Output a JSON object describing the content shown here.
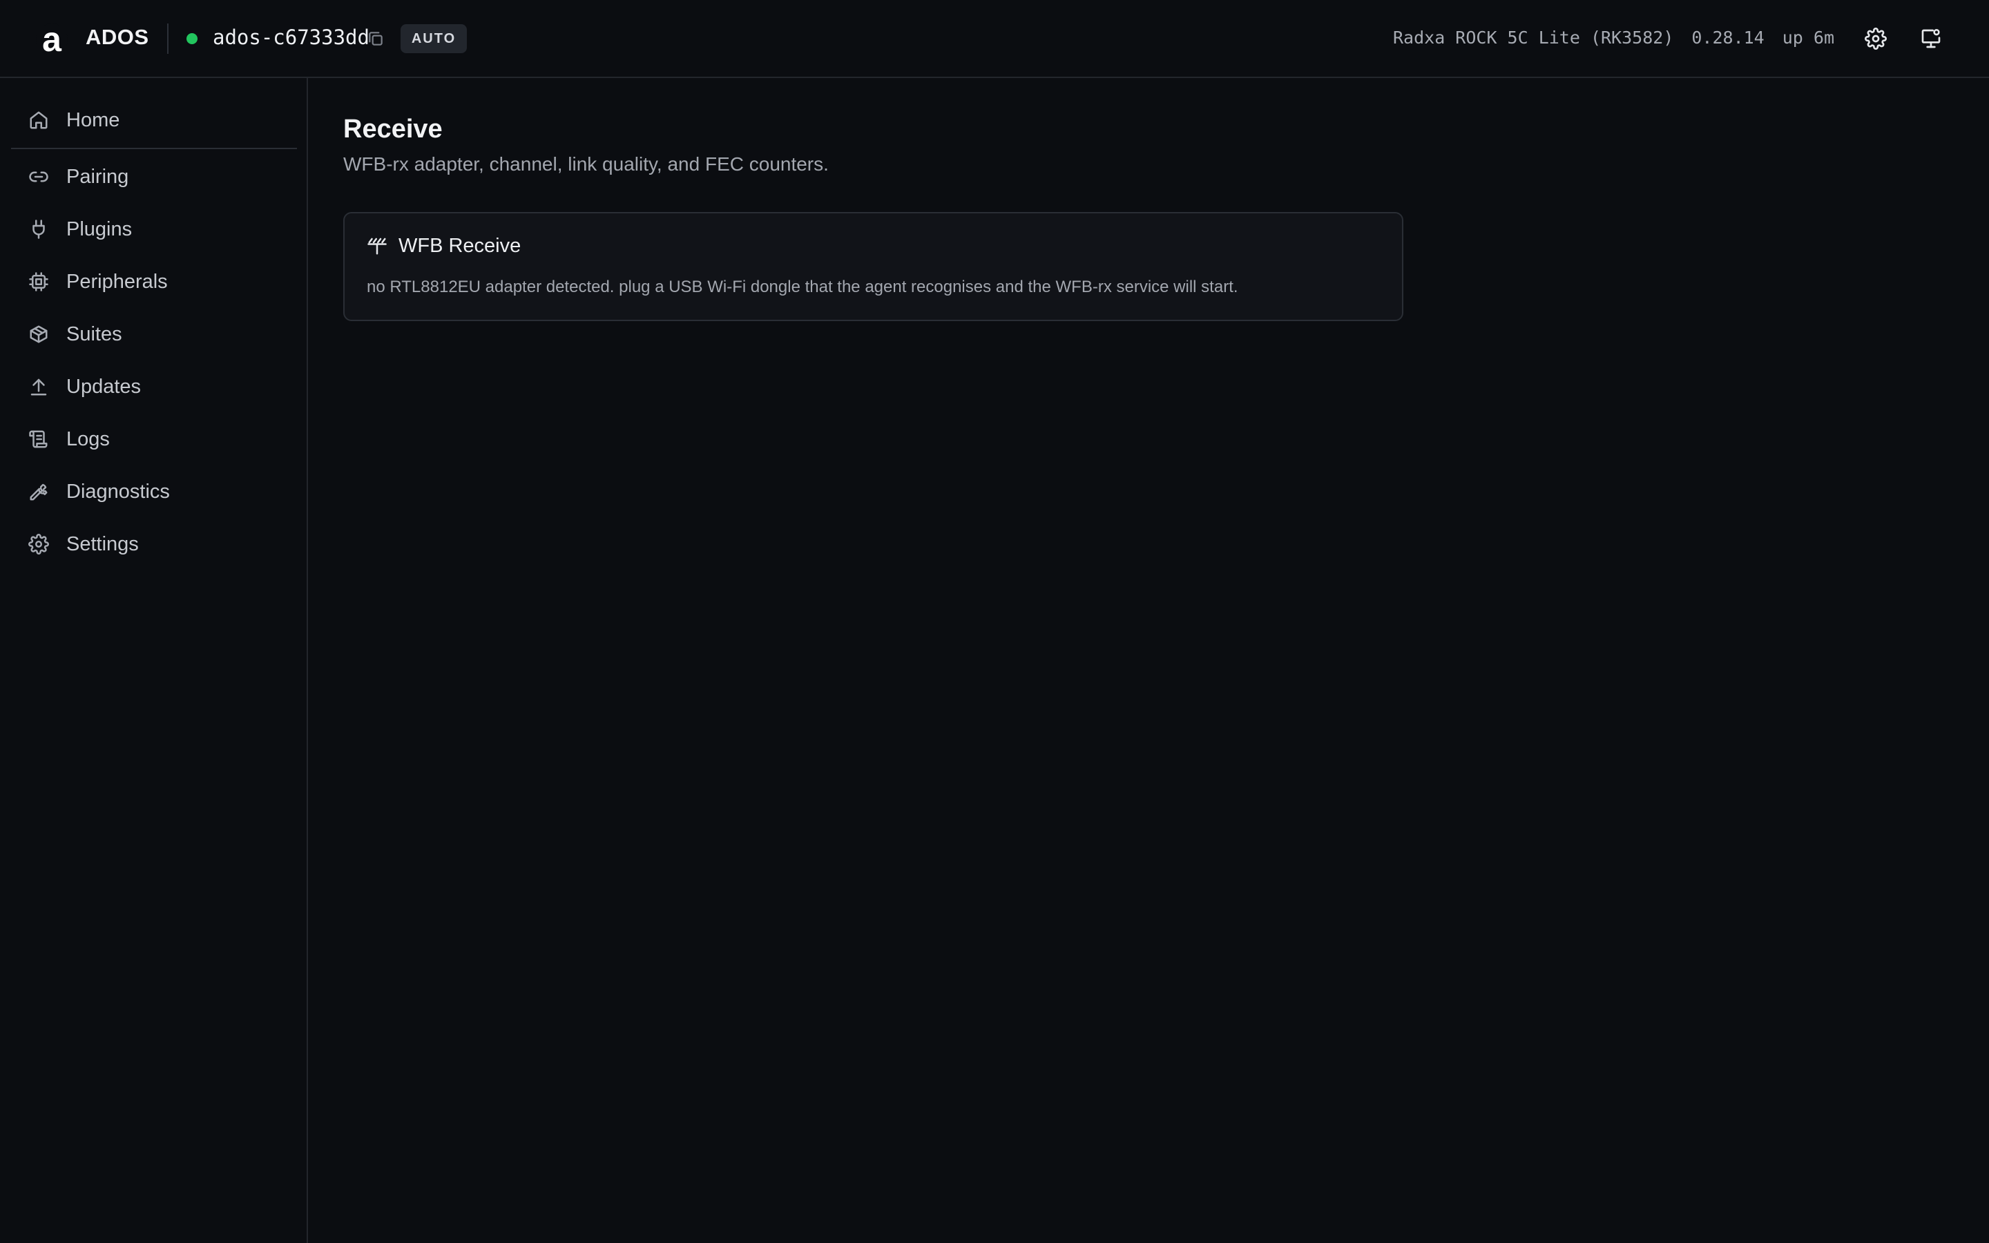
{
  "header": {
    "logo_letter": "a",
    "brand": "ADOS",
    "device_id": "ados-c67333dd",
    "mode_badge": "AUTO",
    "board": "Radxa ROCK 5C Lite (RK3582)",
    "version": "0.28.14",
    "uptime": "up 6m",
    "status_color": "#22c55e"
  },
  "sidebar": {
    "items": [
      {
        "label": "Home",
        "icon": "home-icon"
      },
      {
        "label": "Pairing",
        "icon": "link-icon"
      },
      {
        "label": "Plugins",
        "icon": "plug-icon"
      },
      {
        "label": "Peripherals",
        "icon": "chip-icon"
      },
      {
        "label": "Suites",
        "icon": "package-icon"
      },
      {
        "label": "Updates",
        "icon": "upload-icon"
      },
      {
        "label": "Logs",
        "icon": "scroll-icon"
      },
      {
        "label": "Diagnostics",
        "icon": "wrench-icon"
      },
      {
        "label": "Settings",
        "icon": "gear-icon"
      }
    ]
  },
  "main": {
    "title": "Receive",
    "subtitle": "WFB-rx adapter, channel, link quality, and FEC counters.",
    "card": {
      "title": "WFB Receive",
      "icon": "antenna-icon",
      "message": "no RTL8812EU adapter detected. plug a USB Wi-Fi dongle that the agent recognises and the WFB-rx service will start."
    }
  }
}
